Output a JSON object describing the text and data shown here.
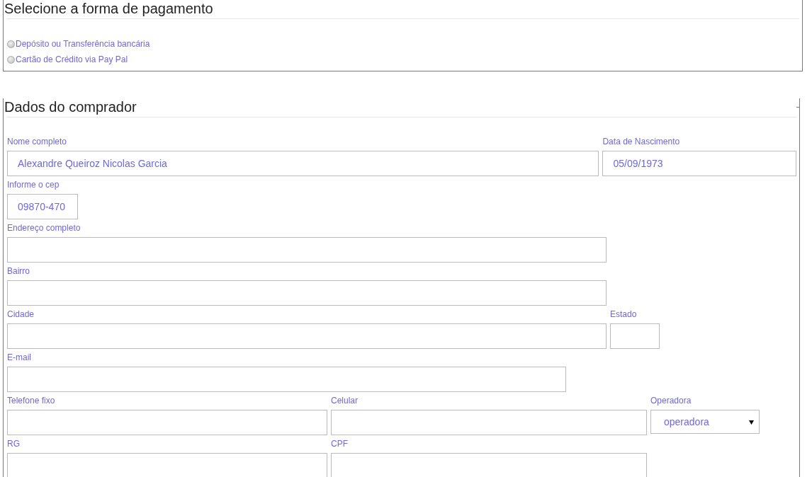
{
  "payment": {
    "title": "Selecione a forma de pagamento",
    "options": [
      {
        "label": "Depósito ou Transferência bancária",
        "selected": false
      },
      {
        "label": "Cartão de Crédito via Pay Pal",
        "selected": false
      }
    ]
  },
  "buyer": {
    "title": "Dados do comprador",
    "rows": [
      [
        {
          "kind": "text",
          "label": "Nome completo",
          "value": "Alexandre Queiroz Nicolas Garcia"
        },
        {
          "kind": "text",
          "label": "Data de Nascimento",
          "value": "05/09/1973"
        }
      ],
      [
        {
          "kind": "text",
          "label": "Informe o cep",
          "value": "09870-470"
        }
      ],
      [
        {
          "kind": "text",
          "label": "Endereço completo"
        }
      ],
      [
        {
          "kind": "text",
          "label": "Bairro"
        }
      ],
      [
        {
          "kind": "text",
          "label": "Cidade"
        },
        {
          "kind": "text",
          "label": "Estado"
        }
      ],
      [
        {
          "kind": "text",
          "label": "E-mail"
        }
      ],
      [
        {
          "kind": "text",
          "label": "Telefone fixo"
        },
        {
          "kind": "text",
          "label": "Celular"
        },
        {
          "kind": "select",
          "label": "Operadora",
          "value": "operadora"
        }
      ],
      [
        {
          "kind": "text",
          "label": "RG"
        },
        {
          "kind": "text",
          "label": "CPF"
        }
      ]
    ]
  }
}
